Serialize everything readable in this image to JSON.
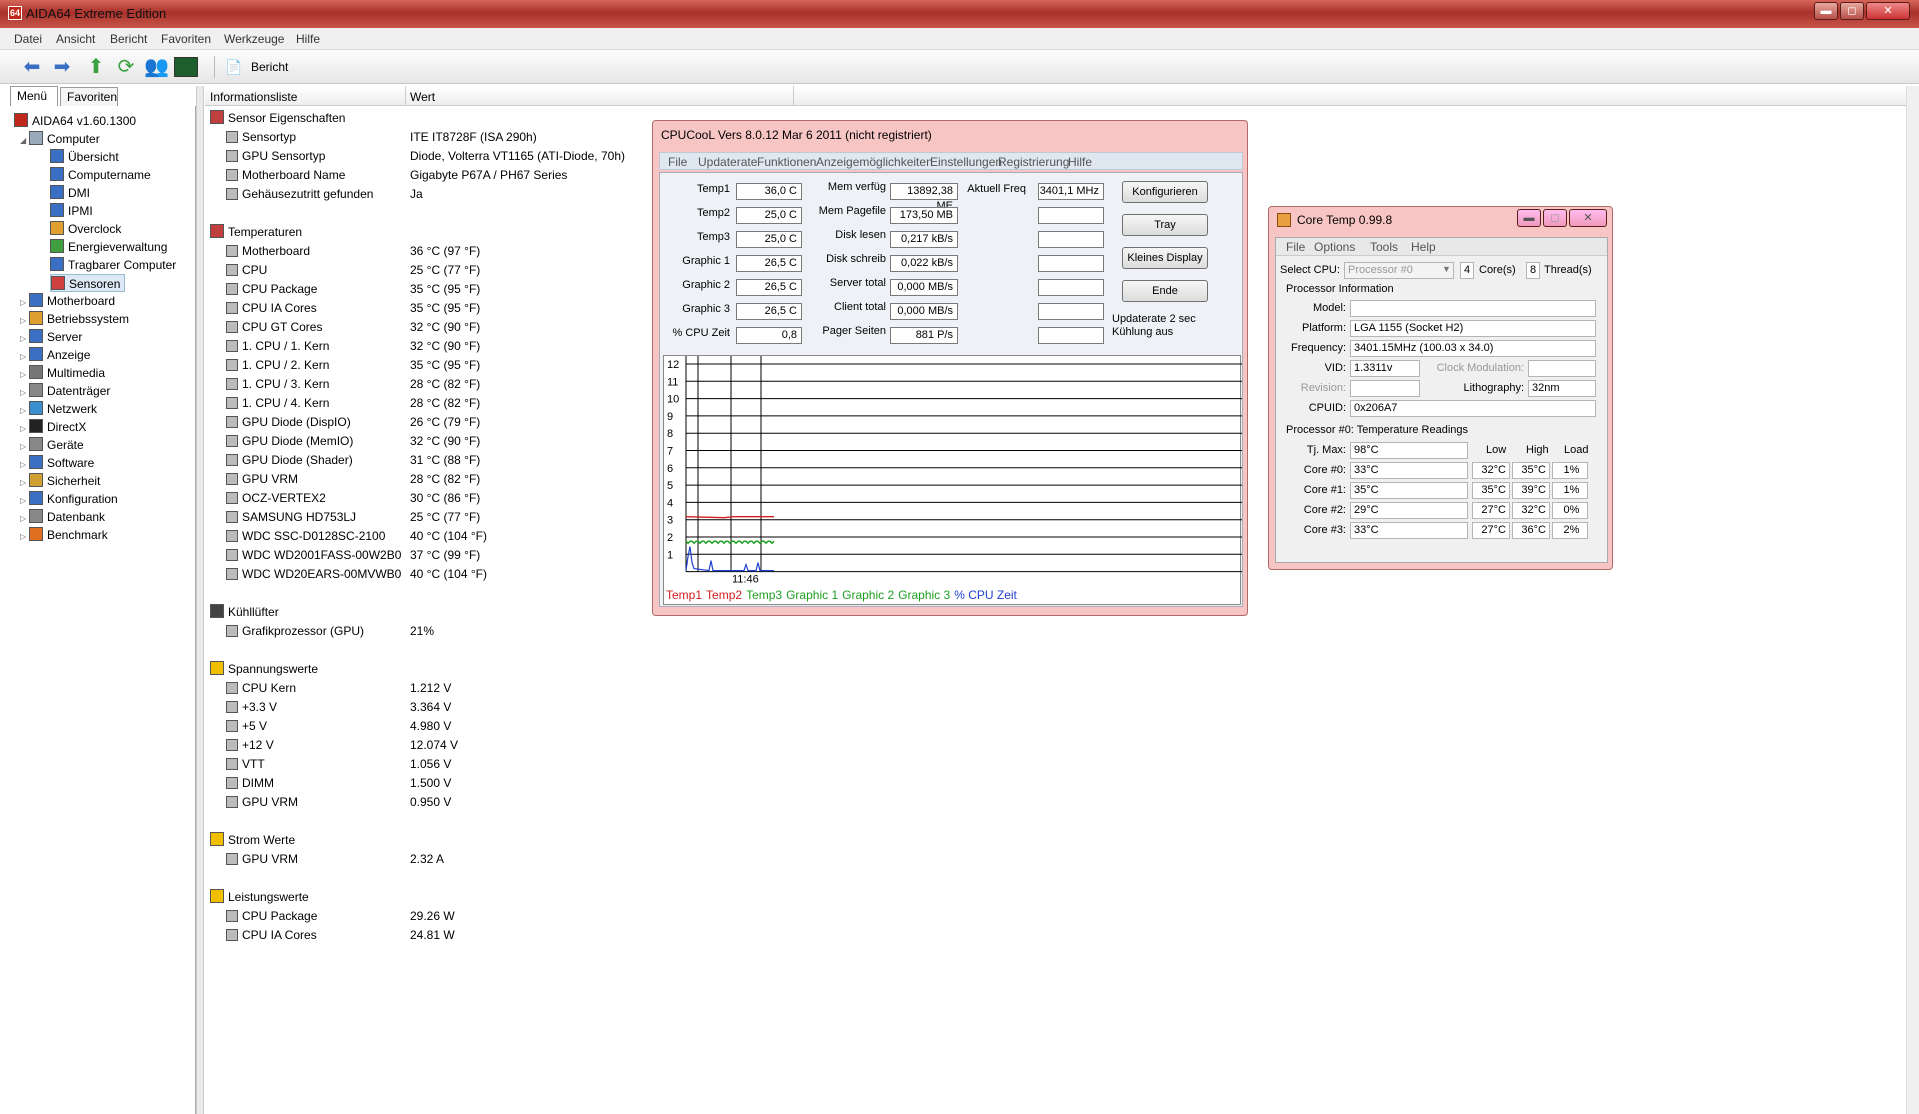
{
  "window": {
    "title": "AIDA64 Extreme Edition",
    "logo": "64",
    "min": "▬",
    "max": "◻",
    "close": "✕"
  },
  "menu": [
    "Datei",
    "Ansicht",
    "Bericht",
    "Favoriten",
    "Werkzeuge",
    "Hilfe"
  ],
  "toolbar": {
    "report_label": "Bericht"
  },
  "left_tabs": {
    "menu": "Menü",
    "favorites": "Favoriten"
  },
  "tree": {
    "root": "AIDA64 v1.60.1300",
    "computer": "Computer",
    "computer_children": [
      "Übersicht",
      "Computername",
      "DMI",
      "IPMI",
      "Overclock",
      "Energieverwaltung",
      "Tragbarer Computer",
      "Sensoren"
    ],
    "top_items": [
      "Motherboard",
      "Betriebssystem",
      "Server",
      "Anzeige",
      "Multimedia",
      "Datenträger",
      "Netzwerk",
      "DirectX",
      "Geräte",
      "Software",
      "Sicherheit",
      "Konfiguration",
      "Datenbank",
      "Benchmark"
    ]
  },
  "list": {
    "col1": "Informationsliste",
    "col2": "Wert",
    "rows": [
      {
        "type": "group",
        "label": "Sensor Eigenschaften",
        "icon": "sensor-icon"
      },
      {
        "type": "item",
        "label": "Sensortyp",
        "value": "ITE IT8728F  (ISA 290h)"
      },
      {
        "type": "item",
        "label": "GPU Sensortyp",
        "value": "Diode, Volterra VT1165  (ATI-Diode, 70h)"
      },
      {
        "type": "item",
        "label": "Motherboard Name",
        "value": "Gigabyte P67A / PH67 Series"
      },
      {
        "type": "item",
        "label": "Gehäusezutritt gefunden",
        "value": "Ja"
      },
      {
        "type": "gap"
      },
      {
        "type": "group",
        "label": "Temperaturen",
        "icon": "thermometer-icon"
      },
      {
        "type": "item",
        "label": "Motherboard",
        "value": "36 °C  (97 °F)"
      },
      {
        "type": "item",
        "label": "CPU",
        "value": "25 °C  (77 °F)"
      },
      {
        "type": "item",
        "label": "CPU Package",
        "value": "35 °C  (95 °F)"
      },
      {
        "type": "item",
        "label": "CPU IA Cores",
        "value": "35 °C  (95 °F)"
      },
      {
        "type": "item",
        "label": "CPU GT Cores",
        "value": "32 °C  (90 °F)"
      },
      {
        "type": "item",
        "label": "1. CPU / 1. Kern",
        "value": "32 °C  (90 °F)"
      },
      {
        "type": "item",
        "label": "1. CPU / 2. Kern",
        "value": "35 °C  (95 °F)"
      },
      {
        "type": "item",
        "label": "1. CPU / 3. Kern",
        "value": "28 °C  (82 °F)"
      },
      {
        "type": "item",
        "label": "1. CPU / 4. Kern",
        "value": "28 °C  (82 °F)"
      },
      {
        "type": "item",
        "label": "GPU Diode (DispIO)",
        "value": "26 °C  (79 °F)"
      },
      {
        "type": "item",
        "label": "GPU Diode (MemIO)",
        "value": "32 °C  (90 °F)"
      },
      {
        "type": "item",
        "label": "GPU Diode (Shader)",
        "value": "31 °C  (88 °F)"
      },
      {
        "type": "item",
        "label": "GPU VRM",
        "value": "28 °C  (82 °F)"
      },
      {
        "type": "item",
        "label": "OCZ-VERTEX2",
        "value": "30 °C  (86 °F)"
      },
      {
        "type": "item",
        "label": "SAMSUNG HD753LJ",
        "value": "25 °C  (77 °F)"
      },
      {
        "type": "item",
        "label": "WDC SSC-D0128SC-2100",
        "value": "40 °C  (104 °F)"
      },
      {
        "type": "item",
        "label": "WDC WD2001FASS-00W2B0",
        "value": "37 °C  (99 °F)"
      },
      {
        "type": "item",
        "label": "WDC WD20EARS-00MVWB0",
        "value": "40 °C  (104 °F)"
      },
      {
        "type": "gap"
      },
      {
        "type": "group",
        "label": "Kühllüfter",
        "icon": "fan-icon"
      },
      {
        "type": "item",
        "label": "Grafikprozessor (GPU)",
        "value": "21%"
      },
      {
        "type": "gap"
      },
      {
        "type": "group",
        "label": "Spannungswerte",
        "icon": "warning-icon"
      },
      {
        "type": "item",
        "label": "CPU Kern",
        "value": "1.212 V"
      },
      {
        "type": "item",
        "label": "+3.3 V",
        "value": "3.364 V"
      },
      {
        "type": "item",
        "label": "+5 V",
        "value": "4.980 V"
      },
      {
        "type": "item",
        "label": "+12 V",
        "value": "12.074 V"
      },
      {
        "type": "item",
        "label": "VTT",
        "value": "1.056 V"
      },
      {
        "type": "item",
        "label": "DIMM",
        "value": "1.500 V"
      },
      {
        "type": "item",
        "label": "GPU VRM",
        "value": "0.950 V"
      },
      {
        "type": "gap"
      },
      {
        "type": "group",
        "label": "Strom Werte",
        "icon": "warning-icon"
      },
      {
        "type": "item",
        "label": "GPU VRM",
        "value": "2.32 A"
      },
      {
        "type": "gap"
      },
      {
        "type": "group",
        "label": "Leistungswerte",
        "icon": "warning-icon"
      },
      {
        "type": "item",
        "label": "CPU Package",
        "value": "29.26 W"
      },
      {
        "type": "item",
        "label": "CPU IA Cores",
        "value": "24.81 W"
      }
    ]
  },
  "cpucool": {
    "title": "CPUCooL  Vers 8.0.12  Mar  6 2011 (nicht registriert)",
    "menu": [
      "File",
      "Updaterate",
      "Funktionen",
      "Anzeigemöglichkeiten",
      "Einstellungen",
      "Registrierung",
      "Hilfe"
    ],
    "col1": [
      {
        "label": "Temp1",
        "value": "36,0 C"
      },
      {
        "label": "Temp2",
        "value": "25,0 C"
      },
      {
        "label": "Temp3",
        "value": "25,0 C"
      },
      {
        "label": "Graphic 1",
        "value": "26,5 C"
      },
      {
        "label": "Graphic 2",
        "value": "26,5 C"
      },
      {
        "label": "Graphic 3",
        "value": "26,5 C"
      },
      {
        "label": "% CPU Zeit",
        "value": "0,8"
      }
    ],
    "col2": [
      {
        "label": "Mem verfüg",
        "value": "13892,38 ME"
      },
      {
        "label": "Mem Pagefile",
        "value": "173,50 MB"
      },
      {
        "label": "Disk lesen",
        "value": "0,217 kB/s"
      },
      {
        "label": "Disk schreib",
        "value": "0,022 kB/s"
      },
      {
        "label": "Server total",
        "value": "0,000 MB/s"
      },
      {
        "label": "Client total",
        "value": "0,000 MB/s"
      },
      {
        "label": "Pager Seiten",
        "value": "881 P/s"
      }
    ],
    "freq_label": "Aktuell Freq",
    "freq_value": "3401,1 MHz",
    "buttons": [
      "Konfigurieren",
      "Tray",
      "Kleines Display",
      "Ende"
    ],
    "update_note": "Updaterate 2 sec",
    "cool_note": "Kühlung aus",
    "graph_y": [
      "12",
      "11",
      "10",
      "9",
      "8",
      "7",
      "6",
      "5",
      "4",
      "3",
      "2",
      "1"
    ],
    "graph_time": "11:46",
    "legend": [
      {
        "name": "Temp1",
        "color": "#d02020"
      },
      {
        "name": "Temp2",
        "color": "#d02020"
      },
      {
        "name": "Temp3",
        "color": "#20a020"
      },
      {
        "name": "Graphic 1",
        "color": "#20a020"
      },
      {
        "name": "Graphic 2",
        "color": "#20a020"
      },
      {
        "name": "Graphic 3",
        "color": "#20a020"
      },
      {
        "name": "% CPU Zeit",
        "color": "#2040d0"
      }
    ]
  },
  "coretemp": {
    "title": "Core Temp 0.99.8",
    "menu": [
      "File",
      "Options",
      "Tools",
      "Help"
    ],
    "select_cpu_label": "Select CPU:",
    "select_cpu_value": "Processor #0",
    "cores_value": "4",
    "cores_label": "Core(s)",
    "threads_value": "8",
    "threads_label": "Thread(s)",
    "proc_info": "Processor Information",
    "model_label": "Model:",
    "model_value": "",
    "platform_label": "Platform:",
    "platform_value": "LGA 1155 (Socket H2)",
    "freq_label": "Frequency:",
    "freq_value": "3401.15MHz (100.03 x 34.0)",
    "vid_label": "VID:",
    "vid_value": "1.3311v",
    "clockmod_label": "Clock Modulation:",
    "clockmod_value": "",
    "revision_label": "Revision:",
    "revision_value": "",
    "litho_label": "Lithography:",
    "litho_value": "32nm",
    "cpuid_label": "CPUID:",
    "cpuid_value": "0x206A7",
    "temp_title": "Processor #0: Temperature Readings",
    "tjmax_label": "Tj. Max:",
    "tjmax_value": "98°C",
    "headers": [
      "Low",
      "High",
      "Load"
    ],
    "cores": [
      {
        "label": "Core #0:",
        "temp": "33°C",
        "low": "32°C",
        "high": "35°C",
        "load": "1%"
      },
      {
        "label": "Core #1:",
        "temp": "35°C",
        "low": "35°C",
        "high": "39°C",
        "load": "1%"
      },
      {
        "label": "Core #2:",
        "temp": "29°C",
        "low": "27°C",
        "high": "32°C",
        "load": "0%"
      },
      {
        "label": "Core #3:",
        "temp": "33°C",
        "low": "27°C",
        "high": "36°C",
        "load": "2%"
      }
    ]
  }
}
